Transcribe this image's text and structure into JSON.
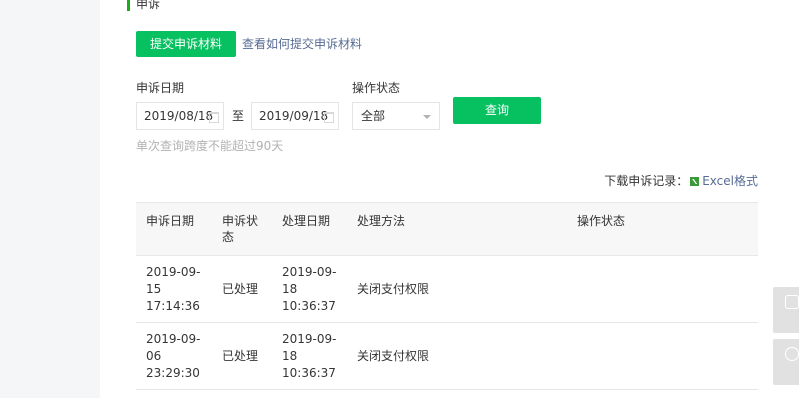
{
  "section": {
    "title": "申诉"
  },
  "actions": {
    "submit_label": "提交申诉材料",
    "howto_link": "查看如何提交申诉材料"
  },
  "filters": {
    "date_label": "申诉日期",
    "date_from": "2019/08/18",
    "date_sep": "至",
    "date_to": "2019/09/18",
    "status_label": "操作状态",
    "status_value": "全部",
    "query_label": "查询",
    "hint": "单次查询跨度不能超过90天"
  },
  "download": {
    "prefix": "下载申诉记录：",
    "format_label": "Excel格式"
  },
  "table": {
    "headers": [
      "申诉日期",
      "申诉状态",
      "处理日期",
      "处理方法",
      "操作状态"
    ],
    "rows": [
      {
        "appeal_date": "2019-09-15 17:14:36",
        "status": "已处理",
        "handle_date": "2019-09-18 10:36:37",
        "method": "关闭支付权限",
        "op_status": ""
      },
      {
        "appeal_date": "2019-09-06 23:29:30",
        "status": "已处理",
        "handle_date": "2019-09-18 10:36:37",
        "method": "关闭支付权限",
        "op_status": ""
      }
    ]
  },
  "colors": {
    "brand_green": "#07c160",
    "link_blue": "#576b95",
    "hint_gray": "#b2b2b2"
  },
  "icons": [
    "calendar-icon",
    "chevron-down-icon",
    "excel-icon",
    "message-icon",
    "help-icon"
  ]
}
